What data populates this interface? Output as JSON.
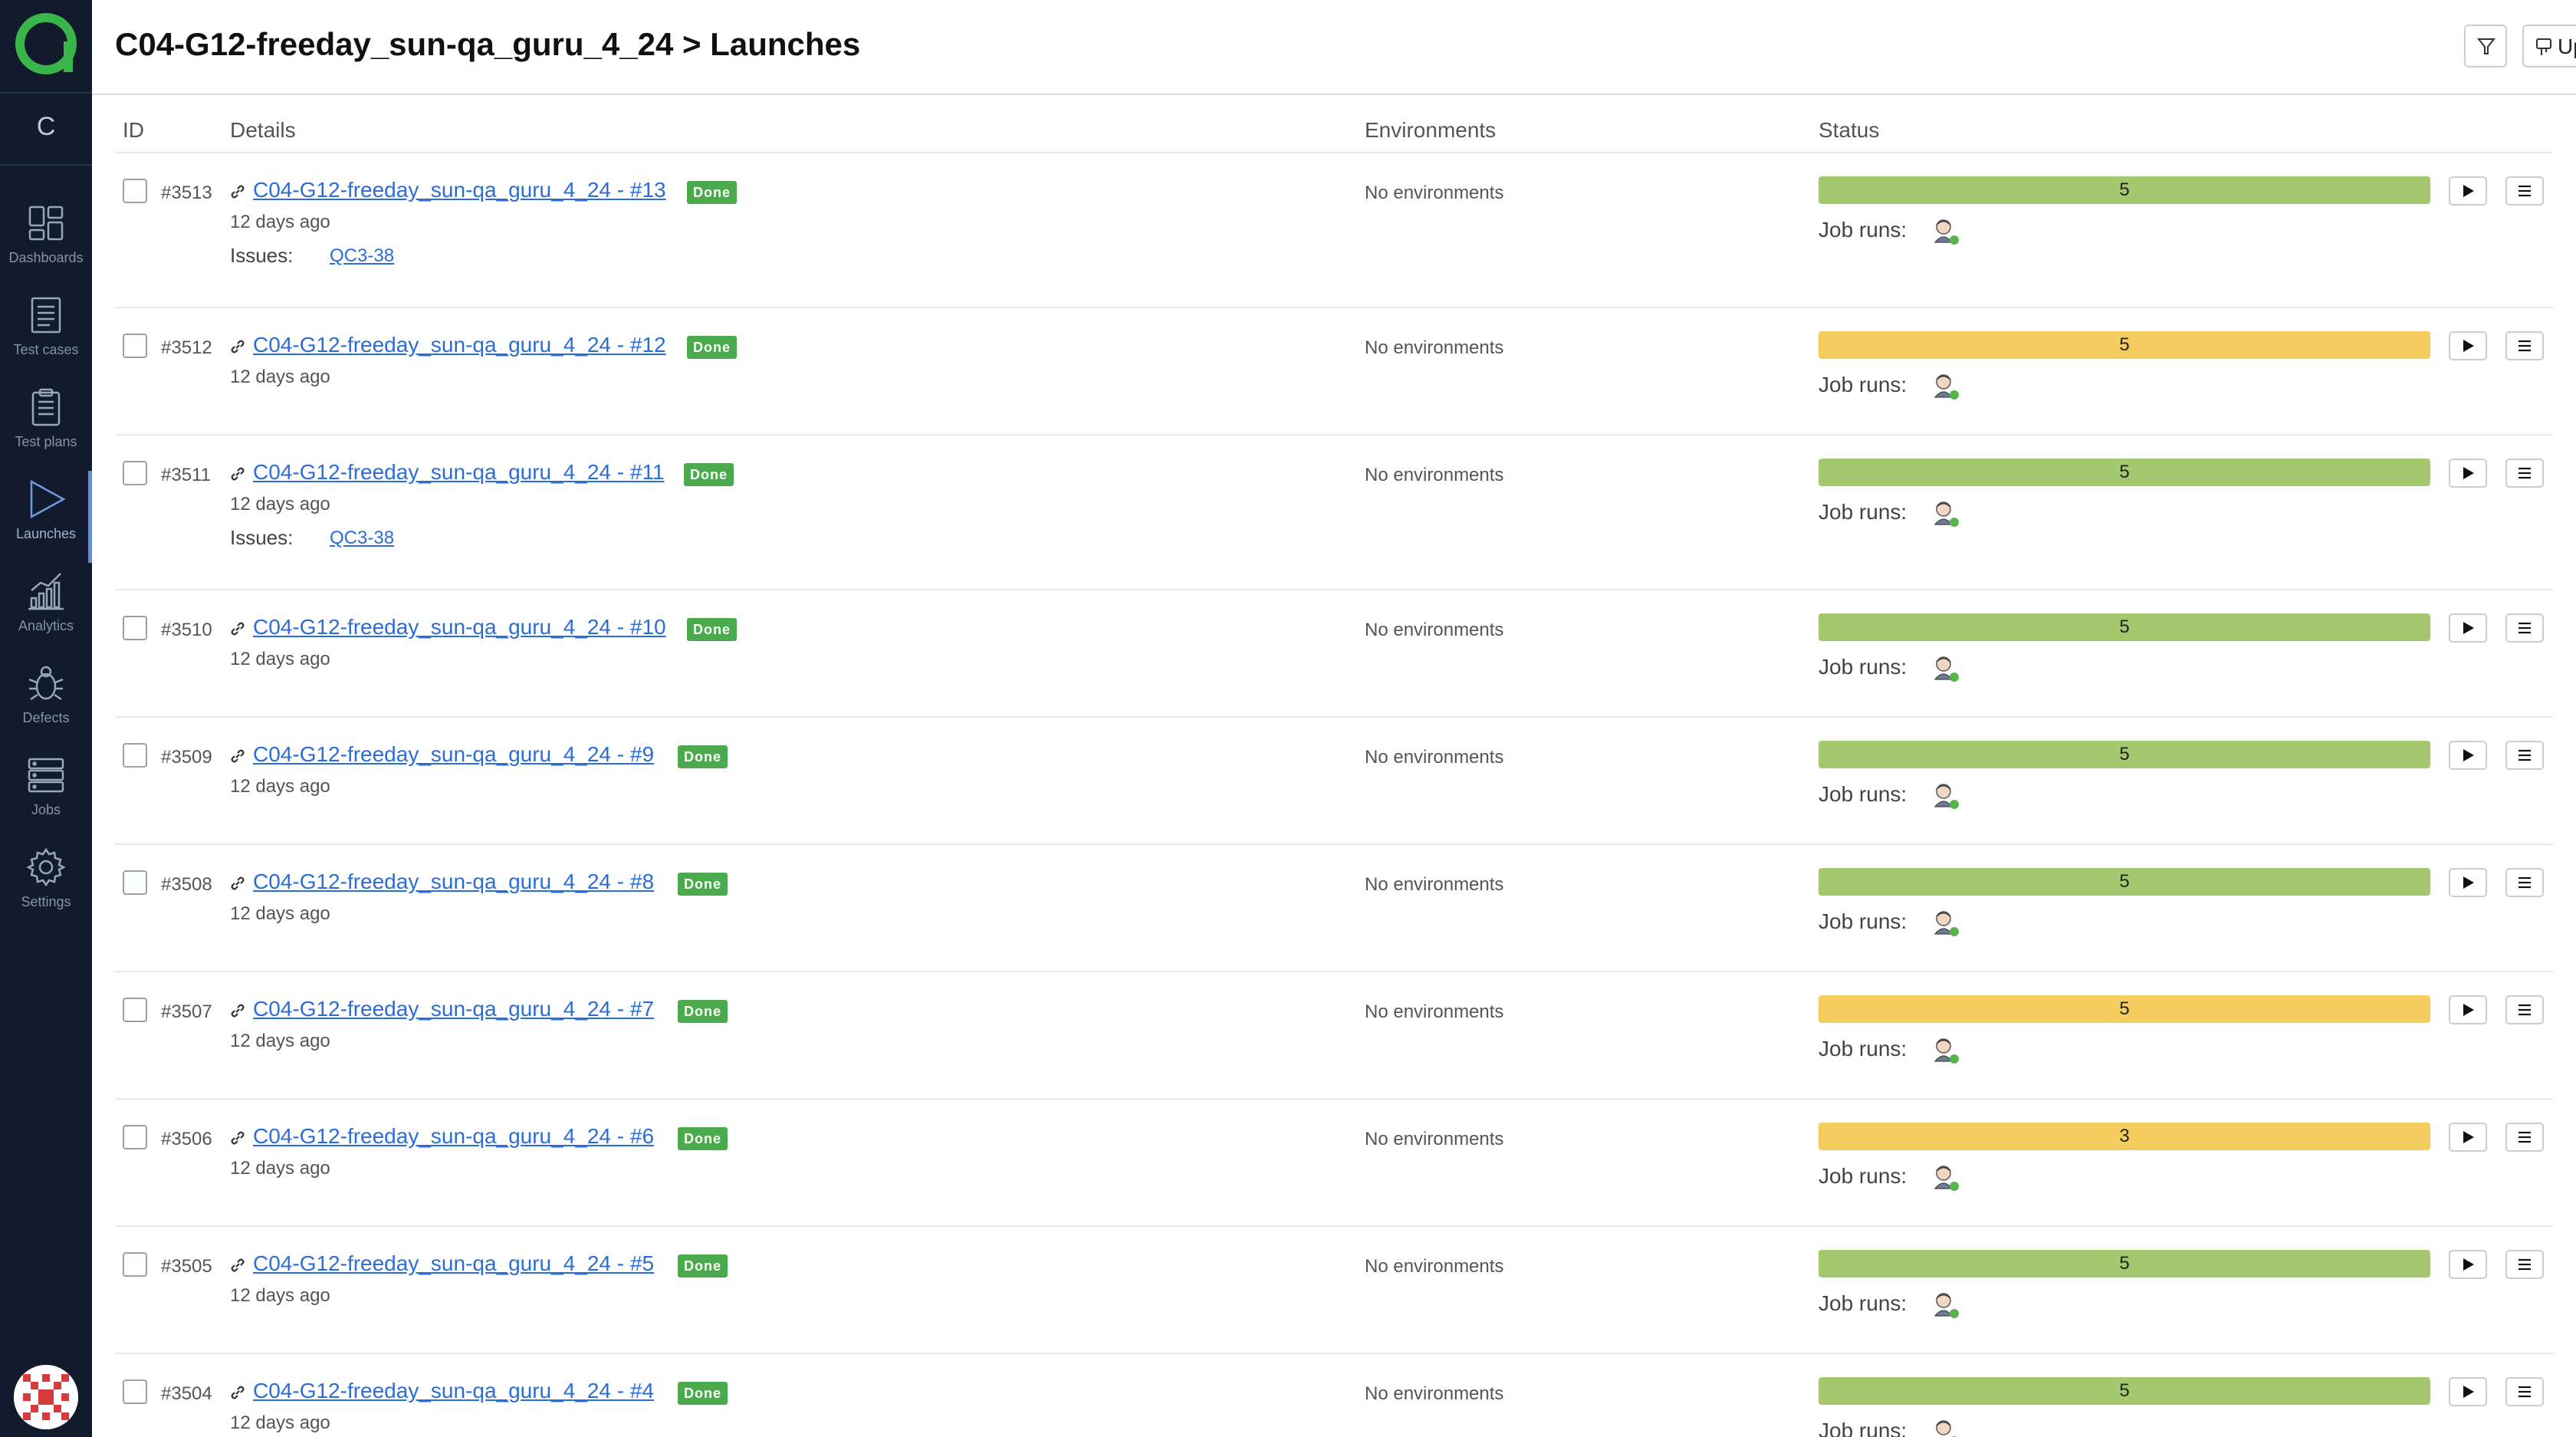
{
  "sidebar": {
    "project_letter": "C",
    "items": [
      {
        "label": "Dashboards",
        "icon": "dashboards-icon"
      },
      {
        "label": "Test cases",
        "icon": "test-cases-icon"
      },
      {
        "label": "Test plans",
        "icon": "test-plans-icon"
      },
      {
        "label": "Launches",
        "icon": "launches-icon",
        "active": true
      },
      {
        "label": "Analytics",
        "icon": "analytics-icon"
      },
      {
        "label": "Defects",
        "icon": "defects-icon"
      },
      {
        "label": "Jobs",
        "icon": "jobs-icon"
      },
      {
        "label": "Settings",
        "icon": "settings-icon"
      }
    ]
  },
  "header": {
    "title": "C04-G12-freeday_sun-qa_guru_4_24 > Launches",
    "upload_label": "Upload"
  },
  "table": {
    "columns": [
      "ID",
      "Details",
      "Environments",
      "Status"
    ],
    "job_runs_label": "Job runs:",
    "issues_label": "Issues:",
    "rows": [
      {
        "id": "#3513",
        "name": "C04-G12-freeday_sun-qa_guru_4_24 - #13",
        "badge": "Done",
        "ago": "12 days ago",
        "issue": "QC3-38",
        "env": "No environments",
        "count": "5",
        "bar": "green"
      },
      {
        "id": "#3512",
        "name": "C04-G12-freeday_sun-qa_guru_4_24 - #12",
        "badge": "Done",
        "ago": "12 days ago",
        "issue": null,
        "env": "No environments",
        "count": "5",
        "bar": "yellow"
      },
      {
        "id": "#3511",
        "name": "C04-G12-freeday_sun-qa_guru_4_24 - #11",
        "badge": "Done",
        "ago": "12 days ago",
        "issue": "QC3-38",
        "env": "No environments",
        "count": "5",
        "bar": "green"
      },
      {
        "id": "#3510",
        "name": "C04-G12-freeday_sun-qa_guru_4_24 - #10",
        "badge": "Done",
        "ago": "12 days ago",
        "issue": null,
        "env": "No environments",
        "count": "5",
        "bar": "green"
      },
      {
        "id": "#3509",
        "name": "C04-G12-freeday_sun-qa_guru_4_24 - #9",
        "badge": "Done",
        "ago": "12 days ago",
        "issue": null,
        "env": "No environments",
        "count": "5",
        "bar": "green"
      },
      {
        "id": "#3508",
        "name": "C04-G12-freeday_sun-qa_guru_4_24 - #8",
        "badge": "Done",
        "ago": "12 days ago",
        "issue": null,
        "env": "No environments",
        "count": "5",
        "bar": "green"
      },
      {
        "id": "#3507",
        "name": "C04-G12-freeday_sun-qa_guru_4_24 - #7",
        "badge": "Done",
        "ago": "12 days ago",
        "issue": null,
        "env": "No environments",
        "count": "5",
        "bar": "yellow"
      },
      {
        "id": "#3506",
        "name": "C04-G12-freeday_sun-qa_guru_4_24 - #6",
        "badge": "Done",
        "ago": "12 days ago",
        "issue": null,
        "env": "No environments",
        "count": "3",
        "bar": "yellow"
      },
      {
        "id": "#3505",
        "name": "C04-G12-freeday_sun-qa_guru_4_24 - #5",
        "badge": "Done",
        "ago": "12 days ago",
        "issue": null,
        "env": "No environments",
        "count": "5",
        "bar": "green"
      },
      {
        "id": "#3504",
        "name": "C04-G12-freeday_sun-qa_guru_4_24 - #4",
        "badge": "Done",
        "ago": "12 days ago",
        "issue": null,
        "env": "No environments",
        "count": "5",
        "bar": "green"
      }
    ]
  },
  "colors": {
    "sidebar_bg": "#111b2b",
    "brand_green": "#39b54a",
    "link": "#2b6dd8",
    "done_badge": "#4caa4e",
    "bar_green": "#a3c86d",
    "bar_yellow": "#f5cd5e"
  }
}
